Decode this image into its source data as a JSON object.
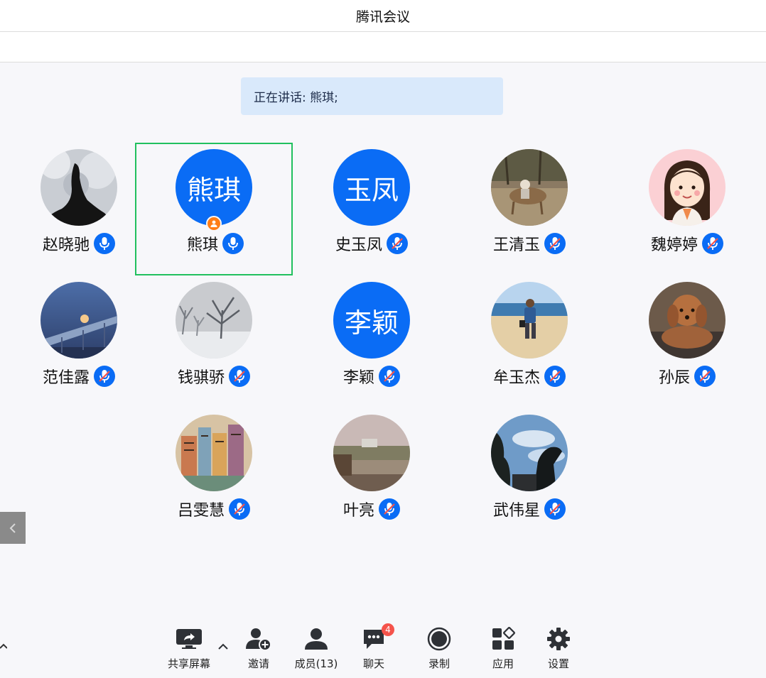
{
  "window": {
    "title": "腾讯会议"
  },
  "banner": {
    "speaking_text": "正在讲话: 熊琪;"
  },
  "participants": [
    {
      "name": "赵晓驰",
      "avatar": "photo",
      "avatar_text": "",
      "mic": "on",
      "host": false,
      "active": false
    },
    {
      "name": "熊琪",
      "avatar": "text",
      "avatar_text": "熊琪",
      "mic": "on",
      "host": true,
      "active": true
    },
    {
      "name": "史玉凤",
      "avatar": "text",
      "avatar_text": "玉凤",
      "mic": "muted",
      "host": false,
      "active": false
    },
    {
      "name": "王清玉",
      "avatar": "photo",
      "avatar_text": "",
      "mic": "muted",
      "host": false,
      "active": false
    },
    {
      "name": "魏婷婷",
      "avatar": "photo",
      "avatar_text": "",
      "mic": "muted",
      "host": false,
      "active": false
    },
    {
      "name": "范佳露",
      "avatar": "photo",
      "avatar_text": "",
      "mic": "muted",
      "host": false,
      "active": false
    },
    {
      "name": "钱骐骄",
      "avatar": "photo",
      "avatar_text": "",
      "mic": "muted",
      "host": false,
      "active": false
    },
    {
      "name": "李颖",
      "avatar": "text",
      "avatar_text": "李颖",
      "mic": "muted",
      "host": false,
      "active": false
    },
    {
      "name": "牟玉杰",
      "avatar": "photo",
      "avatar_text": "",
      "mic": "muted",
      "host": false,
      "active": false
    },
    {
      "name": "孙辰",
      "avatar": "photo",
      "avatar_text": "",
      "mic": "muted",
      "host": false,
      "active": false
    },
    {
      "name": "吕雯慧",
      "avatar": "photo",
      "avatar_text": "",
      "mic": "muted",
      "host": false,
      "active": false
    },
    {
      "name": "叶亮",
      "avatar": "photo",
      "avatar_text": "",
      "mic": "muted",
      "host": false,
      "active": false
    },
    {
      "name": "武伟星",
      "avatar": "photo",
      "avatar_text": "",
      "mic": "muted",
      "host": false,
      "active": false
    }
  ],
  "toolbar": {
    "share_screen": "共享屏幕",
    "invite": "邀请",
    "members": "成员(13)",
    "chat": "聊天",
    "chat_badge": "4",
    "record": "录制",
    "apps": "应用",
    "settings": "设置"
  },
  "colors": {
    "accent": "#0a6cf5",
    "active_border": "#21c05e",
    "host_badge": "#ff7d16",
    "notification": "#f5534b",
    "banner_bg": "#d9e9fb"
  }
}
